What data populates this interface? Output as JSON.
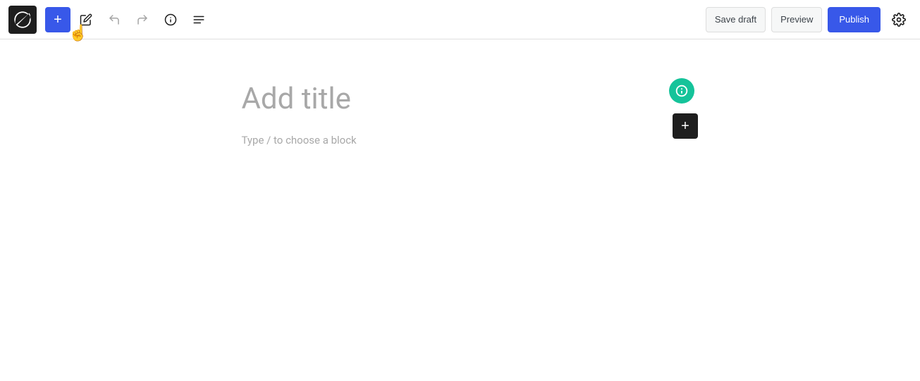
{
  "toolbar": {
    "add_label": "+",
    "save_draft_label": "Save draft",
    "preview_label": "Preview",
    "publish_label": "Publish",
    "wp_logo_alt": "WordPress",
    "settings_icon": "gear"
  },
  "editor": {
    "title_placeholder": "Add title",
    "block_placeholder": "Type / to choose a block"
  },
  "icons": {
    "pencil": "pencil-icon",
    "undo": "undo-icon",
    "redo": "redo-icon",
    "info": "info-icon",
    "list": "list-icon",
    "grammarly": "grammarly-icon",
    "add_block": "add-block-icon",
    "settings": "settings-icon"
  }
}
